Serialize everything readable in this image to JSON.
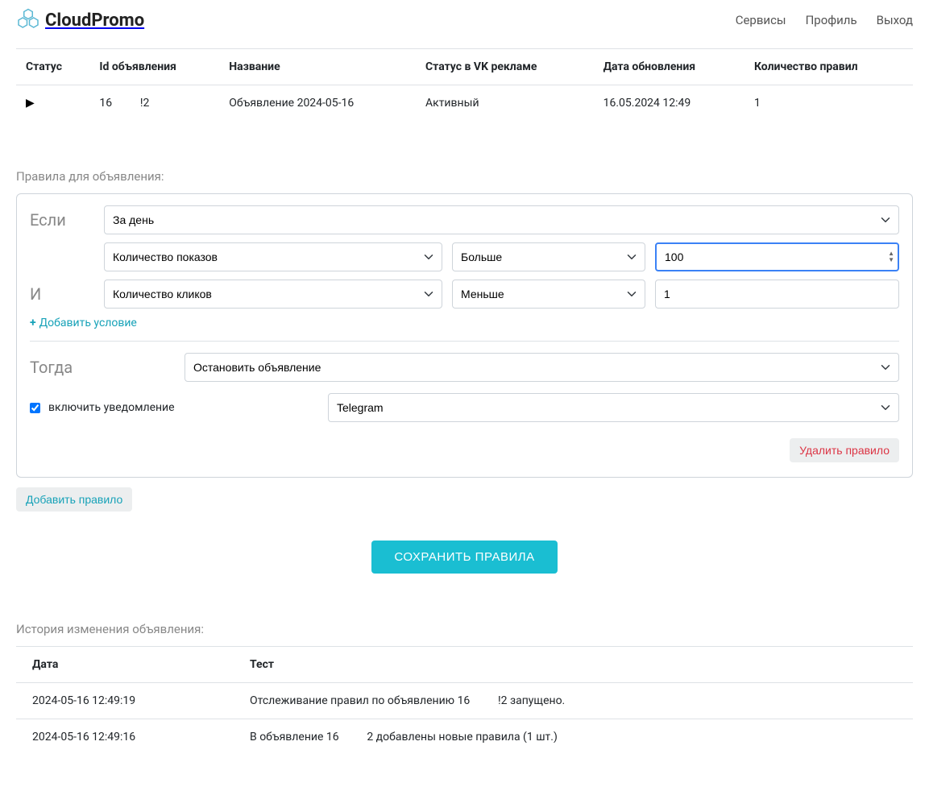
{
  "header": {
    "brand": "CloudPromo",
    "nav": {
      "services": "Сервисы",
      "profile": "Профиль",
      "logout": "Выход"
    }
  },
  "ads_table": {
    "columns": {
      "status": "Статус",
      "ad_id": "Id объявления",
      "name": "Название",
      "vk_status": "Статус в VK рекламе",
      "updated": "Дата обновления",
      "rules_count": "Количество правил"
    },
    "rows": [
      {
        "ad_id": "16          !2",
        "name": "Объявление 2024-05-16",
        "vk_status": "Активный",
        "updated": "16.05.2024 12:49",
        "rules_count": "1"
      }
    ]
  },
  "rules_section_title": "Правила для объявления:",
  "rule": {
    "if_label": "Если",
    "and_label": "И",
    "then_label": "Тогда",
    "period": "За день",
    "conditions": [
      {
        "metric": "Количество показов",
        "op": "Больше",
        "value": "100",
        "focused": true
      },
      {
        "metric": "Количество кликов",
        "op": "Меньше",
        "value": "1",
        "focused": false
      }
    ],
    "add_condition": "Добавить условие",
    "action": "Остановить объявление",
    "notify_label": "включить уведомление",
    "notify_checked": true,
    "notify_channel": "Telegram",
    "delete_rule": "Удалить правило"
  },
  "add_rule_button": "Добавить правило",
  "save_button": "СОХРАНИТЬ ПРАВИЛА",
  "history": {
    "title": "История изменения объявления:",
    "columns": {
      "date": "Дата",
      "text": "Тест"
    },
    "rows": [
      {
        "date": "2024-05-16 12:49:19",
        "text": "Отслеживание правил по объявлению 16          !2 запущено."
      },
      {
        "date": "2024-05-16 12:49:16",
        "text": "В объявление 16          2 добавлены новые правила (1 шт.)"
      }
    ]
  }
}
